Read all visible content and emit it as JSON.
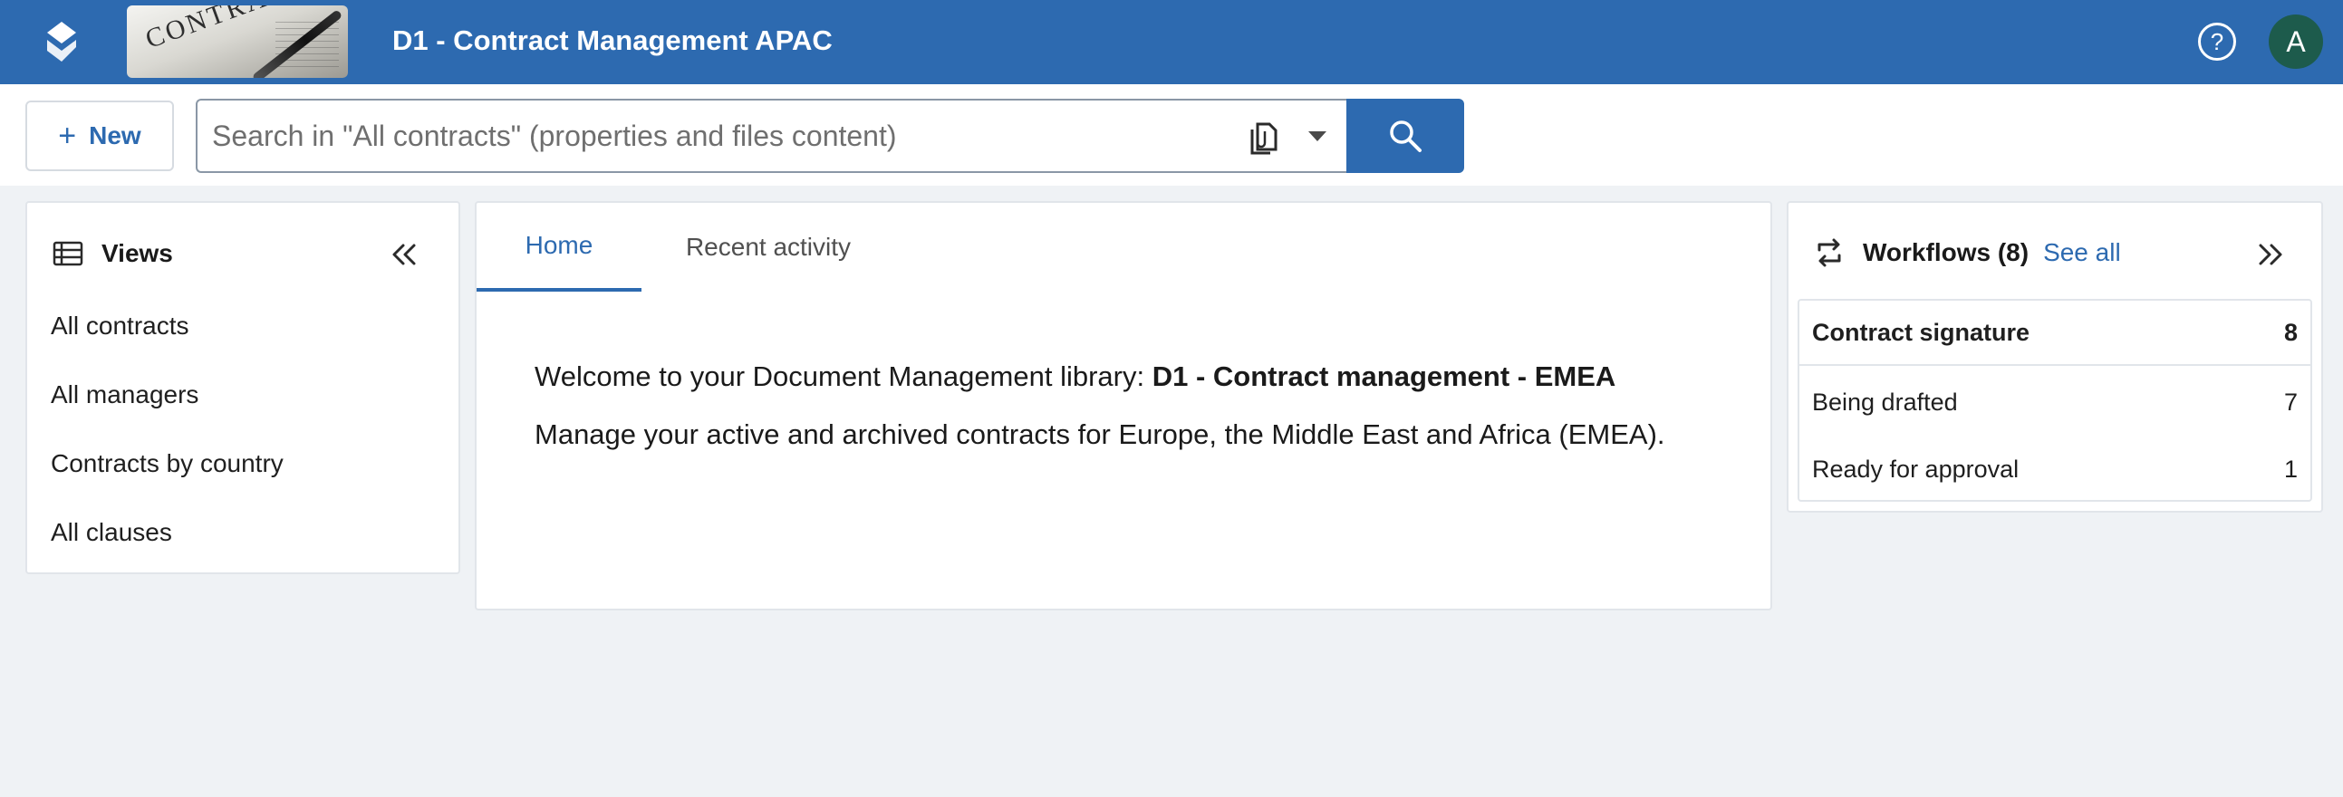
{
  "header": {
    "title": "D1 - Contract Management APAC",
    "thumbnail_word": "CONTRACT",
    "help_glyph": "?",
    "avatar_initial": "A",
    "brand_color": "#2d6ab0"
  },
  "toolbar": {
    "new_label": "New",
    "search_placeholder": "Search in \"All contracts\" (properties and files content)"
  },
  "views": {
    "title": "Views",
    "items": [
      {
        "label": "All contracts"
      },
      {
        "label": "All managers"
      },
      {
        "label": "Contracts by country"
      },
      {
        "label": "All clauses"
      }
    ]
  },
  "main": {
    "tabs": [
      {
        "label": "Home",
        "active": true
      },
      {
        "label": "Recent activity",
        "active": false
      }
    ],
    "welcome_prefix": "Welcome to your Document Management library: ",
    "library_name": "D1 - Contract management - EMEA",
    "description": "Manage your active and archived contracts for Europe, the Middle East and Africa (EMEA)."
  },
  "workflows": {
    "title": "Workflows (8)",
    "see_all": "See all",
    "group": {
      "label": "Contract signature",
      "count": "8"
    },
    "items": [
      {
        "label": "Being drafted",
        "count": "7"
      },
      {
        "label": "Ready for approval",
        "count": "1"
      }
    ]
  }
}
